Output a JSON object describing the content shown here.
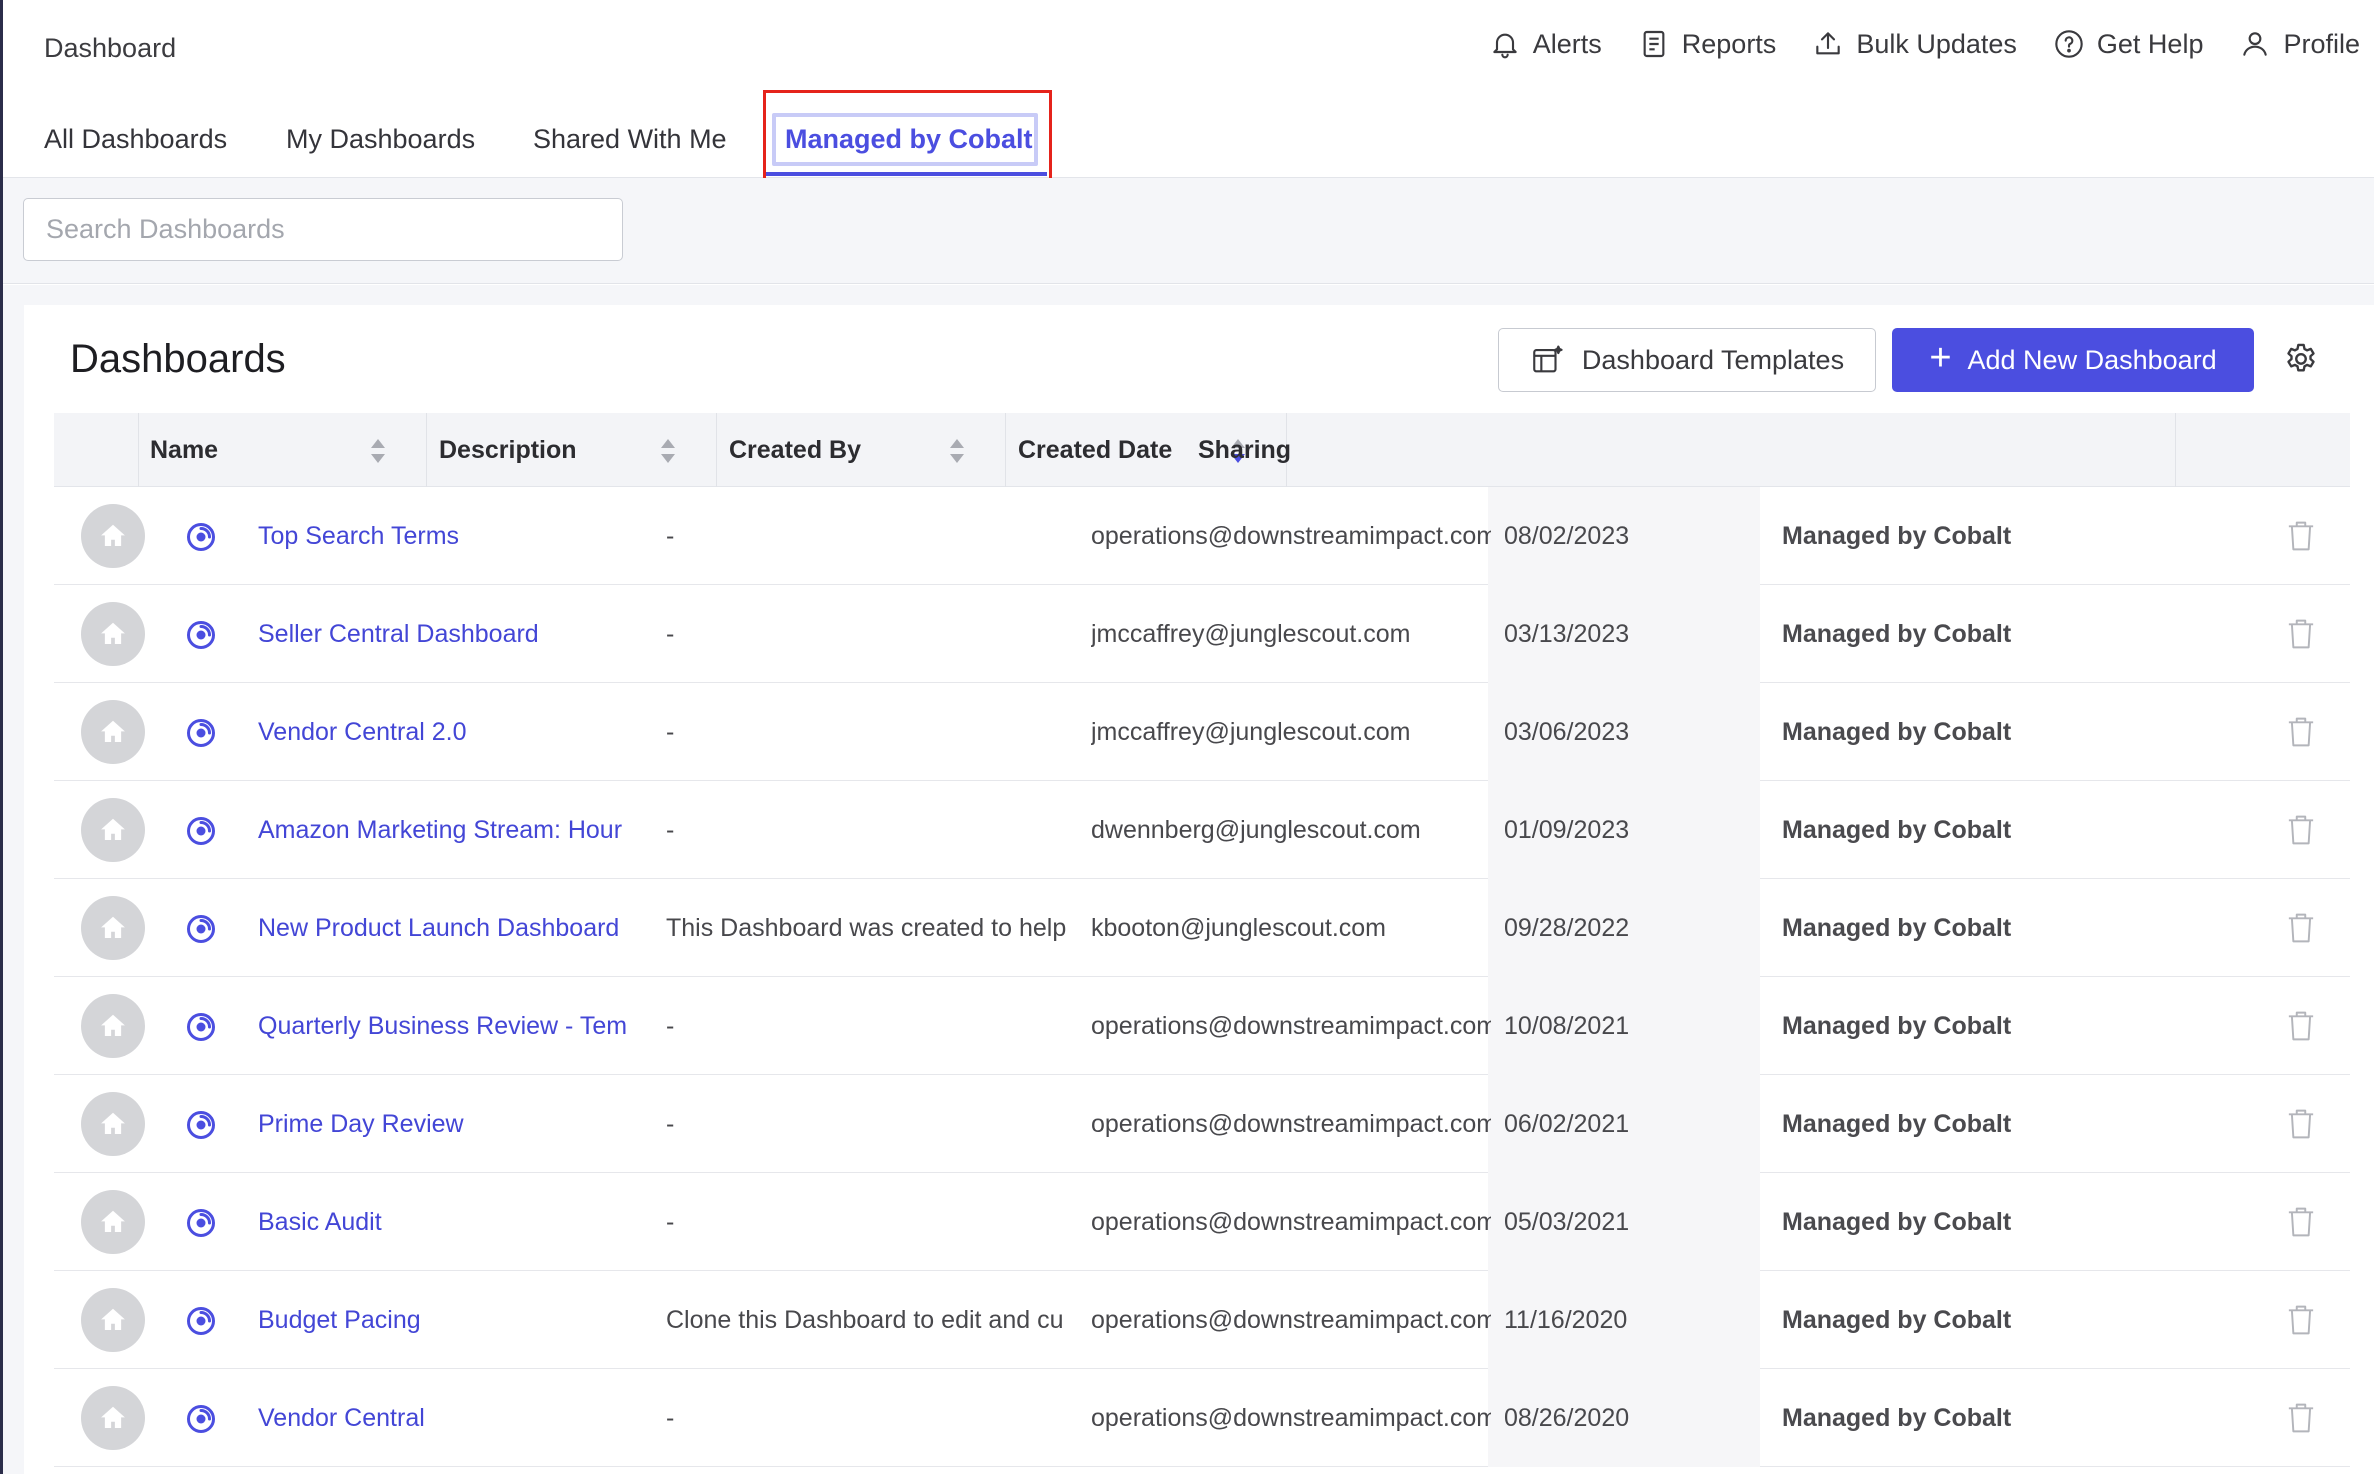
{
  "header": {
    "title": "Dashboard",
    "actions": [
      {
        "label": "Alerts",
        "icon": "bell-icon"
      },
      {
        "label": "Reports",
        "icon": "document-icon"
      },
      {
        "label": "Bulk Updates",
        "icon": "upload-icon"
      },
      {
        "label": "Get Help",
        "icon": "help-circle-icon"
      },
      {
        "label": "Profile",
        "icon": "user-icon"
      }
    ]
  },
  "tabs": [
    {
      "label": "All Dashboards",
      "active": false
    },
    {
      "label": "My Dashboards",
      "active": false
    },
    {
      "label": "Shared With Me",
      "active": false
    },
    {
      "label": "Managed by Cobalt",
      "active": true
    }
  ],
  "search": {
    "placeholder": "Search Dashboards",
    "value": ""
  },
  "card": {
    "title": "Dashboards",
    "templates_label": "Dashboard Templates",
    "add_label": "Add New Dashboard"
  },
  "table": {
    "columns": [
      "Name",
      "Description",
      "Created By",
      "Created Date",
      "Sharing"
    ],
    "sorted_column": "Created Date",
    "rows": [
      {
        "name": "Top Search Terms",
        "description": "-",
        "created_by": "operations@downstreamimpact.com",
        "created_date": "08/02/2023",
        "sharing": "Managed by Cobalt"
      },
      {
        "name": "Seller Central Dashboard",
        "description": "-",
        "created_by": "jmccaffrey@junglescout.com",
        "created_date": "03/13/2023",
        "sharing": "Managed by Cobalt"
      },
      {
        "name": "Vendor Central 2.0",
        "description": "-",
        "created_by": "jmccaffrey@junglescout.com",
        "created_date": "03/06/2023",
        "sharing": "Managed by Cobalt"
      },
      {
        "name": "Amazon Marketing Stream: Hour",
        "description": "-",
        "created_by": "dwennberg@junglescout.com",
        "created_date": "01/09/2023",
        "sharing": "Managed by Cobalt"
      },
      {
        "name": "New Product Launch Dashboard",
        "description": "This Dashboard was created to help",
        "created_by": "kbooton@junglescout.com",
        "created_date": "09/28/2022",
        "sharing": "Managed by Cobalt"
      },
      {
        "name": "Quarterly Business Review - Tem",
        "description": "-",
        "created_by": "operations@downstreamimpact.com",
        "created_date": "10/08/2021",
        "sharing": "Managed by Cobalt"
      },
      {
        "name": "Prime Day Review",
        "description": "-",
        "created_by": "operations@downstreamimpact.com",
        "created_date": "06/02/2021",
        "sharing": "Managed by Cobalt"
      },
      {
        "name": "Basic Audit",
        "description": "-",
        "created_by": "operations@downstreamimpact.com",
        "created_date": "05/03/2021",
        "sharing": "Managed by Cobalt"
      },
      {
        "name": "Budget Pacing",
        "description": "Clone this Dashboard to edit and cu",
        "created_by": "operations@downstreamimpact.com",
        "created_date": "11/16/2020",
        "sharing": "Managed by Cobalt"
      },
      {
        "name": "Vendor Central",
        "description": "-",
        "created_by": "operations@downstreamimpact.com",
        "created_date": "08/26/2020",
        "sharing": "Managed by Cobalt"
      }
    ]
  },
  "colors": {
    "accent": "#4b4ee0",
    "link": "#4346d6",
    "highlight_box": "#e5231b",
    "avatar": "#d4d5d8"
  }
}
